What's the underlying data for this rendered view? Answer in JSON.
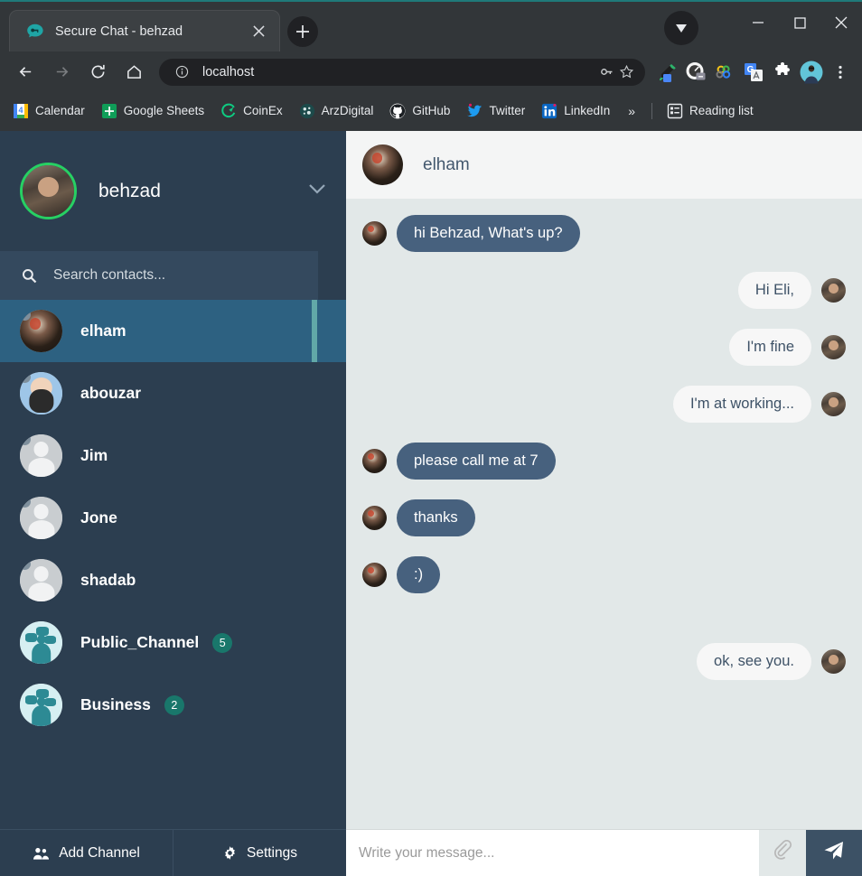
{
  "browser": {
    "tab": {
      "title": "Secure Chat - behzad",
      "favicon_icon": "chat-key-icon",
      "close_icon": "close-icon"
    },
    "newtab_icon": "plus-icon",
    "window_controls": {
      "minimize": "—",
      "maximize": "□",
      "close": "✕"
    },
    "nav": {
      "back_icon": "arrow-left-icon",
      "forward_icon": "arrow-right-icon",
      "reload_icon": "reload-icon",
      "home_icon": "home-icon"
    },
    "omnibox": {
      "info_icon": "info-circle-icon",
      "url": "localhost",
      "key_icon": "key-icon",
      "star_icon": "star-icon"
    },
    "extensions": [
      "eyedropper-icon",
      "speedometer-icon",
      "colorpicker-rings-icon",
      "google-translate-icon",
      "puzzle-icon",
      "profile-avatar-icon",
      "three-dots-menu-icon"
    ],
    "bookmarks": [
      {
        "label": "Calendar",
        "icon": "calendar-icon"
      },
      {
        "label": "Google Sheets",
        "icon": "sheets-icon"
      },
      {
        "label": "CoinEx",
        "icon": "coinex-icon"
      },
      {
        "label": "ArzDigital",
        "icon": "arzdigital-icon"
      },
      {
        "label": "GitHub",
        "icon": "github-icon"
      },
      {
        "label": "Twitter",
        "icon": "twitter-icon"
      },
      {
        "label": "LinkedIn",
        "icon": "linkedin-icon"
      }
    ],
    "overflow_label": "»",
    "reading_list": {
      "label": "Reading list",
      "icon": "reading-list-icon"
    }
  },
  "sidebar": {
    "user": {
      "name": "behzad",
      "avatar": "user-photo",
      "status_color": "#27d063",
      "caret_icon": "chevron-down-icon"
    },
    "search": {
      "placeholder": "Search contacts...",
      "value": "",
      "icon": "search-icon"
    },
    "contacts": [
      {
        "name": "elham",
        "avatar": "photo-elham",
        "badge": "",
        "active": true,
        "online_dot": true
      },
      {
        "name": "abouzar",
        "avatar": "photo-abouzar",
        "badge": "",
        "active": false,
        "online_dot": true
      },
      {
        "name": "Jim",
        "avatar": "default-user",
        "badge": "",
        "active": false,
        "online_dot": true
      },
      {
        "name": "Jone",
        "avatar": "default-user",
        "badge": "",
        "active": false,
        "online_dot": true
      },
      {
        "name": "shadab",
        "avatar": "default-user",
        "badge": "",
        "active": false,
        "online_dot": true
      },
      {
        "name": "Public_Channel",
        "avatar": "group-channel",
        "badge": "5",
        "active": false,
        "online_dot": false
      },
      {
        "name": "Business",
        "avatar": "group-channel",
        "badge": "2",
        "active": false,
        "online_dot": false
      }
    ],
    "footer": {
      "add_channel_label": "Add Channel",
      "add_channel_icon": "users-group-icon",
      "settings_label": "Settings",
      "settings_icon": "gear-icon"
    }
  },
  "chat": {
    "header": {
      "name": "elham",
      "avatar": "photo-elham"
    },
    "messages": [
      {
        "dir": "in",
        "text": "hi Behzad, What's up?",
        "avatar": "photo-elham"
      },
      {
        "dir": "out",
        "text": "Hi Eli,",
        "avatar": "user-photo"
      },
      {
        "dir": "out",
        "text": "I'm fine",
        "avatar": "user-photo"
      },
      {
        "dir": "out",
        "text": "I'm at working...",
        "avatar": "user-photo"
      },
      {
        "dir": "in",
        "text": "please call me at 7",
        "avatar": "photo-elham"
      },
      {
        "dir": "in",
        "text": "thanks",
        "avatar": "photo-elham"
      },
      {
        "dir": "in",
        "text": ":)",
        "avatar": "photo-elham"
      },
      {
        "dir": "out",
        "text": "ok, see you.",
        "avatar": "user-photo"
      }
    ],
    "composer": {
      "placeholder": "Write your message...",
      "value": "",
      "attach_icon": "paperclip-icon",
      "send_icon": "paper-plane-icon"
    }
  },
  "colors": {
    "sidebar_bg": "#2c3e50",
    "sidebar_active": "#2d6181",
    "accent_bar": "#62a8a8",
    "badge": "#19776b",
    "bubble_in": "#47617e",
    "bubble_out": "#f7f7f7",
    "chat_bg": "#e2e8e8",
    "online": "#27d063",
    "browser_chrome": "#323639",
    "bottom_bar": "#1f7a7a"
  }
}
